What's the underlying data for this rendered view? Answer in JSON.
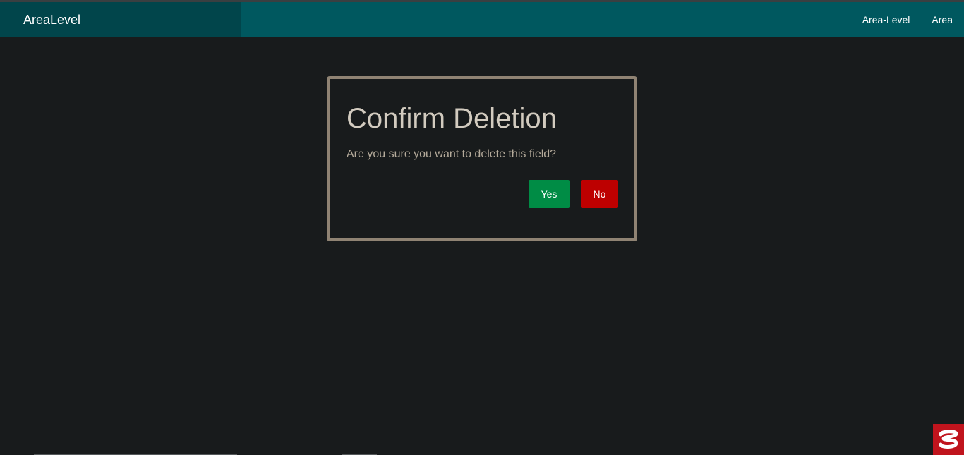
{
  "navbar": {
    "brand": "AreaLevel",
    "links": [
      {
        "label": "Area-Level"
      },
      {
        "label": "Area"
      }
    ],
    "background_color": "#00585f",
    "brand_background_color": "#01454b"
  },
  "dialog": {
    "title": "Confirm Deletion",
    "message": "Are you sure you want to delete this field?",
    "yes_label": "Yes",
    "no_label": "No",
    "yes_color": "#008c45",
    "no_color": "#bd0000",
    "border_color": "#8f8373"
  },
  "corner_widget": {
    "icon": "app-logo-icon",
    "color": "#c0141d"
  }
}
